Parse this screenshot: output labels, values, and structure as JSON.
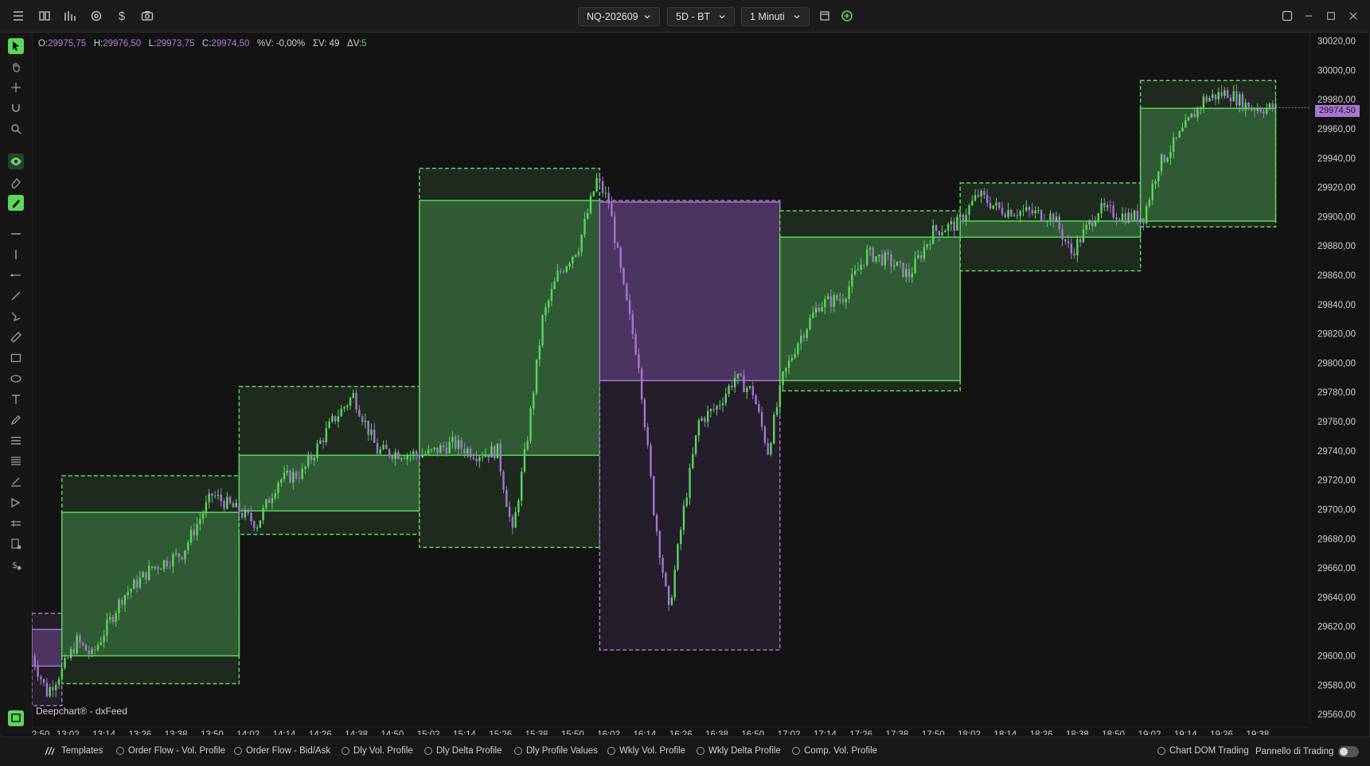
{
  "topbar": {
    "symbol": "NQ-202609",
    "range": "5D - BT",
    "interval": "1 Minuti",
    "icons": [
      "menu-icon",
      "layout-icon",
      "bars-icon",
      "settings-icon",
      "dollar-icon",
      "camera-icon"
    ]
  },
  "ohlc": {
    "o_label": "O:",
    "o": "29975,75",
    "h_label": "H:",
    "h": "29976,50",
    "l_label": "L:",
    "l": "29973,75",
    "c_label": "C:",
    "c": "29974,50",
    "pv": "%V: -0,00%",
    "sv": "ΣV: 49",
    "dv_label": "ΔV:",
    "dv": "5"
  },
  "current_price": "29974,50",
  "source_label": "Deepchart® - dxFeed",
  "bottombar": {
    "templates": "Templates",
    "options": [
      "Order Flow - Vol. Profile",
      "Order Flow - Bid/Ask",
      "Dly Vol. Profile",
      "Dly Delta Profile",
      "Dly Profile Values",
      "Wkly Vol. Profile",
      "Wkly Delta Profile",
      "Comp. Vol. Profile"
    ],
    "chart_dom": "Chart DOM Trading",
    "trading_panel": "Pannello di Trading"
  },
  "colors": {
    "bull": "#5cd65c",
    "bear": "#a576cf",
    "bg": "#131313"
  },
  "chart_data": {
    "type": "candlestick",
    "y_ticks": [
      "30020,00",
      "30000,00",
      "29980,00",
      "29960,00",
      "29940,00",
      "29920,00",
      "29900,00",
      "29880,00",
      "29860,00",
      "29840,00",
      "29820,00",
      "29800,00",
      "29780,00",
      "29760,00",
      "29740,00",
      "29720,00",
      "29700,00",
      "29680,00",
      "29660,00",
      "29640,00",
      "29620,00",
      "29600,00",
      "29580,00",
      "29560,00"
    ],
    "x_ticks": [
      "2:50",
      "13:02",
      "13:14",
      "13:26",
      "13:38",
      "13:50",
      "14:02",
      "14:14",
      "14:26",
      "14:38",
      "14:50",
      "15:02",
      "15:14",
      "15:26",
      "15:38",
      "15:50",
      "16:02",
      "16:14",
      "16:26",
      "16:38",
      "16:50",
      "17:02",
      "17:14",
      "17:26",
      "17:38",
      "17:50",
      "18:02",
      "18:14",
      "18:26",
      "18:38",
      "18:50",
      "19:02",
      "19:14",
      "19:26",
      "19:38"
    ],
    "ylim": [
      29553,
      30023
    ],
    "xlim": [
      "12:50",
      "19:55"
    ],
    "ranges": [
      {
        "dir": "bear",
        "t0": "12:50",
        "t1": "13:00",
        "high": 29629,
        "low": 29566,
        "open": 29618,
        "close": 29593
      },
      {
        "dir": "bull",
        "t0": "13:00",
        "t1": "13:59",
        "high": 29723,
        "low": 29581,
        "open": 29600,
        "close": 29698
      },
      {
        "dir": "bull",
        "t0": "13:59",
        "t1": "14:59",
        "high": 29784,
        "low": 29683,
        "open": 29699,
        "close": 29737
      },
      {
        "dir": "bull",
        "t0": "14:59",
        "t1": "15:59",
        "high": 29933,
        "low": 29674,
        "open": 29737,
        "close": 29911
      },
      {
        "dir": "bear",
        "t0": "15:59",
        "t1": "16:59",
        "high": 29911,
        "low": 29604,
        "open": 29910,
        "close": 29788
      },
      {
        "dir": "bull",
        "t0": "16:59",
        "t1": "17:59",
        "high": 29904,
        "low": 29781,
        "open": 29788,
        "close": 29886
      },
      {
        "dir": "bull",
        "t0": "17:59",
        "t1": "18:59",
        "high": 29923,
        "low": 29863,
        "open": 29886,
        "close": 29897
      },
      {
        "dir": "bull",
        "t0": "18:59",
        "t1": "19:44",
        "high": 29993,
        "low": 29893,
        "open": 29897,
        "close": 29974
      }
    ],
    "path": [
      [
        "12:50",
        29600
      ],
      [
        "12:55",
        29575
      ],
      [
        "13:00",
        29590
      ],
      [
        "13:05",
        29610
      ],
      [
        "13:10",
        29600
      ],
      [
        "13:20",
        29640
      ],
      [
        "13:30",
        29660
      ],
      [
        "13:40",
        29670
      ],
      [
        "13:50",
        29710
      ],
      [
        "13:58",
        29700
      ],
      [
        "14:05",
        29690
      ],
      [
        "14:12",
        29720
      ],
      [
        "14:20",
        29725
      ],
      [
        "14:30",
        29760
      ],
      [
        "14:37",
        29778
      ],
      [
        "14:45",
        29740
      ],
      [
        "14:55",
        29738
      ],
      [
        "15:02",
        29738
      ],
      [
        "15:10",
        29745
      ],
      [
        "15:18",
        29738
      ],
      [
        "15:25",
        29740
      ],
      [
        "15:30",
        29683
      ],
      [
        "15:35",
        29750
      ],
      [
        "15:40",
        29830
      ],
      [
        "15:45",
        29860
      ],
      [
        "15:52",
        29880
      ],
      [
        "15:58",
        29925
      ],
      [
        "16:02",
        29910
      ],
      [
        "16:07",
        29850
      ],
      [
        "16:12",
        29800
      ],
      [
        "16:17",
        29700
      ],
      [
        "16:22",
        29630
      ],
      [
        "16:27",
        29700
      ],
      [
        "16:32",
        29760
      ],
      [
        "16:38",
        29770
      ],
      [
        "16:44",
        29790
      ],
      [
        "16:50",
        29780
      ],
      [
        "16:55",
        29740
      ],
      [
        "17:00",
        29790
      ],
      [
        "17:05",
        29815
      ],
      [
        "17:12",
        29840
      ],
      [
        "17:20",
        29845
      ],
      [
        "17:28",
        29875
      ],
      [
        "17:35",
        29870
      ],
      [
        "17:42",
        29860
      ],
      [
        "17:50",
        29890
      ],
      [
        "17:58",
        29895
      ],
      [
        "18:05",
        29915
      ],
      [
        "18:12",
        29905
      ],
      [
        "18:22",
        29903
      ],
      [
        "18:30",
        29900
      ],
      [
        "18:36",
        29875
      ],
      [
        "18:45",
        29905
      ],
      [
        "18:55",
        29900
      ],
      [
        "19:00",
        29900
      ],
      [
        "19:05",
        29935
      ],
      [
        "19:12",
        29955
      ],
      [
        "19:20",
        29980
      ],
      [
        "19:28",
        29985
      ],
      [
        "19:35",
        29975
      ],
      [
        "19:44",
        29974
      ]
    ]
  }
}
